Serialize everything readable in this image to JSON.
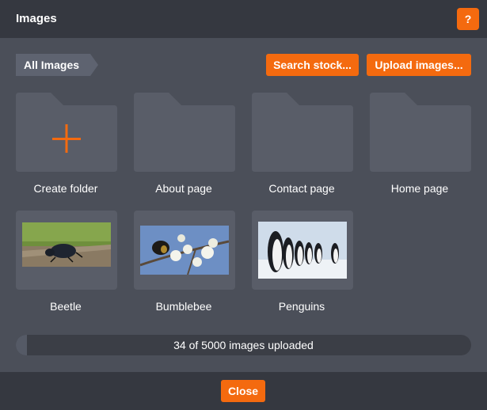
{
  "dialog": {
    "title": "Images",
    "help_label": "?",
    "breadcrumb": "All Images",
    "search_label": "Search stock...",
    "upload_label": "Upload images...",
    "close_label": "Close"
  },
  "folders": [
    {
      "label": "Create folder",
      "icon": "plus-icon"
    },
    {
      "label": "About page",
      "icon": "folder-icon"
    },
    {
      "label": "Contact page",
      "icon": "folder-icon"
    },
    {
      "label": "Home page",
      "icon": "folder-icon"
    }
  ],
  "images": [
    {
      "label": "Beetle"
    },
    {
      "label": "Bumblebee"
    },
    {
      "label": "Penguins"
    }
  ],
  "upload_status": {
    "text": "34 of 5000 images uploaded",
    "uploaded": 34,
    "limit": 5000
  },
  "colors": {
    "accent": "#f46a0f",
    "panel": "#4b4f59",
    "header": "#353840",
    "folder": "#595d68"
  }
}
